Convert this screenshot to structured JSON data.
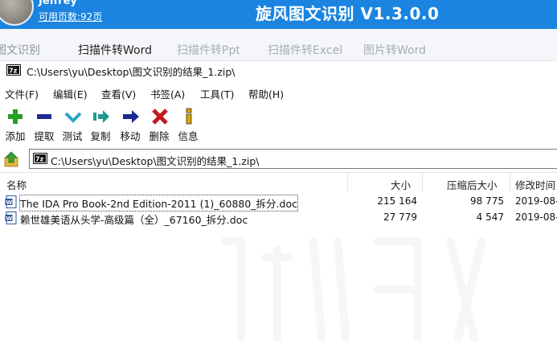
{
  "banner": {
    "username": "Jeffrey",
    "pages_link": "可用页数:92页",
    "app_title": "旋风图文识别 V1.3.0.0",
    "bg_color": "#1a84e0"
  },
  "tabs": [
    {
      "label": "图文识别"
    },
    {
      "label": "扫描件转Word"
    },
    {
      "label": "扫描件转Ppt"
    },
    {
      "label": "扫描件转Excel"
    },
    {
      "label": "图片转Word"
    }
  ],
  "window": {
    "title_path": "C:\\Users\\yu\\Desktop\\图文识别的结果_1.zip\\",
    "menu": [
      "文件(F)",
      "编辑(E)",
      "查看(V)",
      "书签(A)",
      "工具(T)",
      "帮助(H)"
    ],
    "toolbar": [
      {
        "label": "添加",
        "icon": "add-icon",
        "color": "#22a022"
      },
      {
        "label": "提取",
        "icon": "extract-icon",
        "color": "#1d2a8f"
      },
      {
        "label": "测试",
        "icon": "test-icon",
        "color": "#2aa6c8"
      },
      {
        "label": "复制",
        "icon": "copy-icon",
        "color": "#1e9a8a"
      },
      {
        "label": "移动",
        "icon": "move-icon",
        "color": "#1d2a8f"
      },
      {
        "label": "删除",
        "icon": "delete-icon",
        "color": "#c21a1a"
      },
      {
        "label": "信息",
        "icon": "info-icon",
        "color": "#d9a400"
      }
    ],
    "address": "C:\\Users\\yu\\Desktop\\图文识别的结果_1.zip\\",
    "columns": [
      "名称",
      "大小",
      "压缩后大小",
      "修改时间"
    ],
    "files": [
      {
        "name": "The IDA Pro Book-2nd Edition-2011 (1)_60880_拆分.doc",
        "size": "215 164",
        "packed": "98 775",
        "modified": "2019-08-"
      },
      {
        "name": "赖世雄美语从头学-高级篇（全）_67160_拆分.doc",
        "size": "27 779",
        "packed": "4 547",
        "modified": "2019-08-"
      }
    ]
  }
}
